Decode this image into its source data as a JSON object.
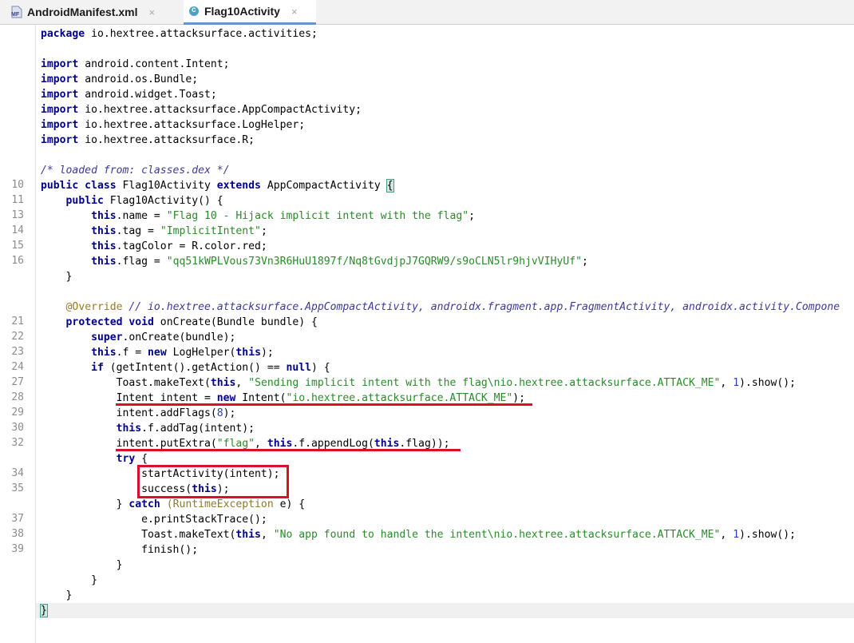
{
  "tabs": [
    {
      "label": "AndroidManifest.xml",
      "close": "×",
      "icon_text": "MF",
      "icon": "manifest-file-icon"
    },
    {
      "label": "Flag10Activity",
      "close": "×",
      "icon_text": "c",
      "icon": "java-class-icon"
    }
  ],
  "code": [
    {
      "ln": "",
      "tokens": [
        {
          "c": "kw",
          "t": "package"
        },
        {
          "t": " io.hextree.attacksurface.activities;"
        }
      ]
    },
    {
      "ln": "",
      "tokens": []
    },
    {
      "ln": "",
      "tokens": [
        {
          "c": "kw",
          "t": "import"
        },
        {
          "t": " android.content.Intent;"
        }
      ]
    },
    {
      "ln": "",
      "tokens": [
        {
          "c": "kw",
          "t": "import"
        },
        {
          "t": " android.os.Bundle;"
        }
      ]
    },
    {
      "ln": "",
      "tokens": [
        {
          "c": "kw",
          "t": "import"
        },
        {
          "t": " android.widget.Toast;"
        }
      ]
    },
    {
      "ln": "",
      "tokens": [
        {
          "c": "kw",
          "t": "import"
        },
        {
          "t": " io.hextree.attacksurface.AppCompactActivity;"
        }
      ]
    },
    {
      "ln": "",
      "tokens": [
        {
          "c": "kw",
          "t": "import"
        },
        {
          "t": " io.hextree.attacksurface.LogHelper;"
        }
      ]
    },
    {
      "ln": "",
      "tokens": [
        {
          "c": "kw",
          "t": "import"
        },
        {
          "t": " io.hextree.attacksurface.R;"
        }
      ]
    },
    {
      "ln": "",
      "tokens": []
    },
    {
      "ln": "",
      "tokens": [
        {
          "c": "cmt",
          "t": "/* loaded from: classes.dex */"
        }
      ]
    },
    {
      "ln": "10",
      "tokens": [
        {
          "c": "kw",
          "t": "public class"
        },
        {
          "t": " Flag10Activity "
        },
        {
          "c": "kw",
          "t": "extends"
        },
        {
          "t": " AppCompactActivity "
        },
        {
          "c": "brace-hl",
          "t": "{"
        }
      ]
    },
    {
      "ln": "11",
      "tokens": [
        {
          "t": "    "
        },
        {
          "c": "kw",
          "t": "public"
        },
        {
          "t": " Flag10Activity() {"
        }
      ]
    },
    {
      "ln": "13",
      "tokens": [
        {
          "t": "        "
        },
        {
          "c": "kw",
          "t": "this"
        },
        {
          "t": ".name = "
        },
        {
          "c": "str",
          "t": "\"Flag 10 - Hijack implicit intent with the flag\""
        },
        {
          "t": ";"
        }
      ]
    },
    {
      "ln": "14",
      "tokens": [
        {
          "t": "        "
        },
        {
          "c": "kw",
          "t": "this"
        },
        {
          "t": ".tag = "
        },
        {
          "c": "str",
          "t": "\"ImplicitIntent\""
        },
        {
          "t": ";"
        }
      ]
    },
    {
      "ln": "15",
      "tokens": [
        {
          "t": "        "
        },
        {
          "c": "kw",
          "t": "this"
        },
        {
          "t": ".tagColor = R.color.red;"
        }
      ]
    },
    {
      "ln": "16",
      "tokens": [
        {
          "t": "        "
        },
        {
          "c": "kw",
          "t": "this"
        },
        {
          "t": ".flag = "
        },
        {
          "c": "str",
          "t": "\"qq51kWPLVous73Vn3R6HuU1897f/Nq8tGvdjpJ7GQRW9/s9oCLN5lr9hjvVIHyUf\""
        },
        {
          "t": ";"
        }
      ]
    },
    {
      "ln": "",
      "tokens": [
        {
          "t": "    }"
        }
      ]
    },
    {
      "ln": "",
      "tokens": []
    },
    {
      "ln": "",
      "tokens": [
        {
          "t": "    "
        },
        {
          "c": "ann",
          "t": "@Override"
        },
        {
          "t": " "
        },
        {
          "c": "cmt",
          "t": "// io.hextree.attacksurface.AppCompactActivity, androidx.fragment.app.FragmentActivity, androidx.activity.Compone"
        }
      ]
    },
    {
      "ln": "21",
      "tokens": [
        {
          "t": "    "
        },
        {
          "c": "kw",
          "t": "protected void"
        },
        {
          "t": " onCreate(Bundle bundle) {"
        }
      ]
    },
    {
      "ln": "22",
      "tokens": [
        {
          "t": "        "
        },
        {
          "c": "kw",
          "t": "super"
        },
        {
          "t": ".onCreate(bundle);"
        }
      ]
    },
    {
      "ln": "23",
      "tokens": [
        {
          "t": "        "
        },
        {
          "c": "kw",
          "t": "this"
        },
        {
          "t": ".f = "
        },
        {
          "c": "kw",
          "t": "new"
        },
        {
          "t": " LogHelper("
        },
        {
          "c": "kw",
          "t": "this"
        },
        {
          "t": ");"
        }
      ]
    },
    {
      "ln": "24",
      "tokens": [
        {
          "t": "        "
        },
        {
          "c": "kw",
          "t": "if"
        },
        {
          "t": " (getIntent().getAction() == "
        },
        {
          "c": "kw",
          "t": "null"
        },
        {
          "t": ") {"
        }
      ]
    },
    {
      "ln": "27",
      "tokens": [
        {
          "t": "            Toast.makeText("
        },
        {
          "c": "kw",
          "t": "this"
        },
        {
          "t": ", "
        },
        {
          "c": "str",
          "t": "\"Sending implicit intent with the flag\\nio.hextree.attacksurface.ATTACK_ME\""
        },
        {
          "t": ", "
        },
        {
          "c": "num",
          "t": "1"
        },
        {
          "t": ").show();"
        }
      ]
    },
    {
      "ln": "28",
      "tokens": [
        {
          "t": "            Intent intent = "
        },
        {
          "c": "kw",
          "t": "new"
        },
        {
          "t": " Intent("
        },
        {
          "c": "str",
          "t": "\"io.hextree.attacksurface.ATTACK_ME\""
        },
        {
          "t": ");"
        }
      ]
    },
    {
      "ln": "29",
      "tokens": [
        {
          "t": "            intent.addFlags("
        },
        {
          "c": "num",
          "t": "8"
        },
        {
          "t": ");"
        }
      ]
    },
    {
      "ln": "30",
      "tokens": [
        {
          "t": "            "
        },
        {
          "c": "kw",
          "t": "this"
        },
        {
          "t": ".f.addTag(intent);"
        }
      ]
    },
    {
      "ln": "32",
      "tokens": [
        {
          "t": "            intent.putExtra("
        },
        {
          "c": "str",
          "t": "\"flag\""
        },
        {
          "t": ", "
        },
        {
          "c": "kw",
          "t": "this"
        },
        {
          "t": ".f.appendLog("
        },
        {
          "c": "kw",
          "t": "this"
        },
        {
          "t": ".flag));"
        }
      ]
    },
    {
      "ln": "",
      "tokens": [
        {
          "t": "            "
        },
        {
          "c": "kw",
          "t": "try"
        },
        {
          "t": " {"
        }
      ]
    },
    {
      "ln": "34",
      "tokens": [
        {
          "t": "                startActivity(intent);"
        }
      ]
    },
    {
      "ln": "35",
      "tokens": [
        {
          "t": "                success("
        },
        {
          "c": "kw",
          "t": "this"
        },
        {
          "t": ");"
        }
      ]
    },
    {
      "ln": "",
      "tokens": [
        {
          "t": "            } "
        },
        {
          "c": "kw",
          "t": "catch"
        },
        {
          "t": " "
        },
        {
          "c": "dim",
          "t": "(RuntimeException"
        },
        {
          "t": " e) {"
        }
      ]
    },
    {
      "ln": "37",
      "tokens": [
        {
          "t": "                e.printStackTrace();"
        }
      ]
    },
    {
      "ln": "38",
      "tokens": [
        {
          "t": "                Toast.makeText("
        },
        {
          "c": "kw",
          "t": "this"
        },
        {
          "t": ", "
        },
        {
          "c": "str",
          "t": "\"No app found to handle the intent\\nio.hextree.attacksurface.ATTACK_ME\""
        },
        {
          "t": ", "
        },
        {
          "c": "num",
          "t": "1"
        },
        {
          "t": ").show();"
        }
      ]
    },
    {
      "ln": "39",
      "tokens": [
        {
          "t": "                finish();"
        }
      ]
    },
    {
      "ln": "",
      "tokens": [
        {
          "t": "            }"
        }
      ]
    },
    {
      "ln": "",
      "tokens": [
        {
          "t": "        }"
        }
      ]
    },
    {
      "ln": "",
      "tokens": [
        {
          "t": "    }"
        }
      ]
    },
    {
      "ln": "",
      "tokens": [
        {
          "c": "brace-hl",
          "t": "}"
        }
      ]
    }
  ],
  "colors": {
    "keyword": "#00008b",
    "string": "#2a8a2a",
    "comment": "#3a3a9a",
    "annotation_marker": "#d8102a",
    "active_tab_underline": "#6a8fd2"
  }
}
